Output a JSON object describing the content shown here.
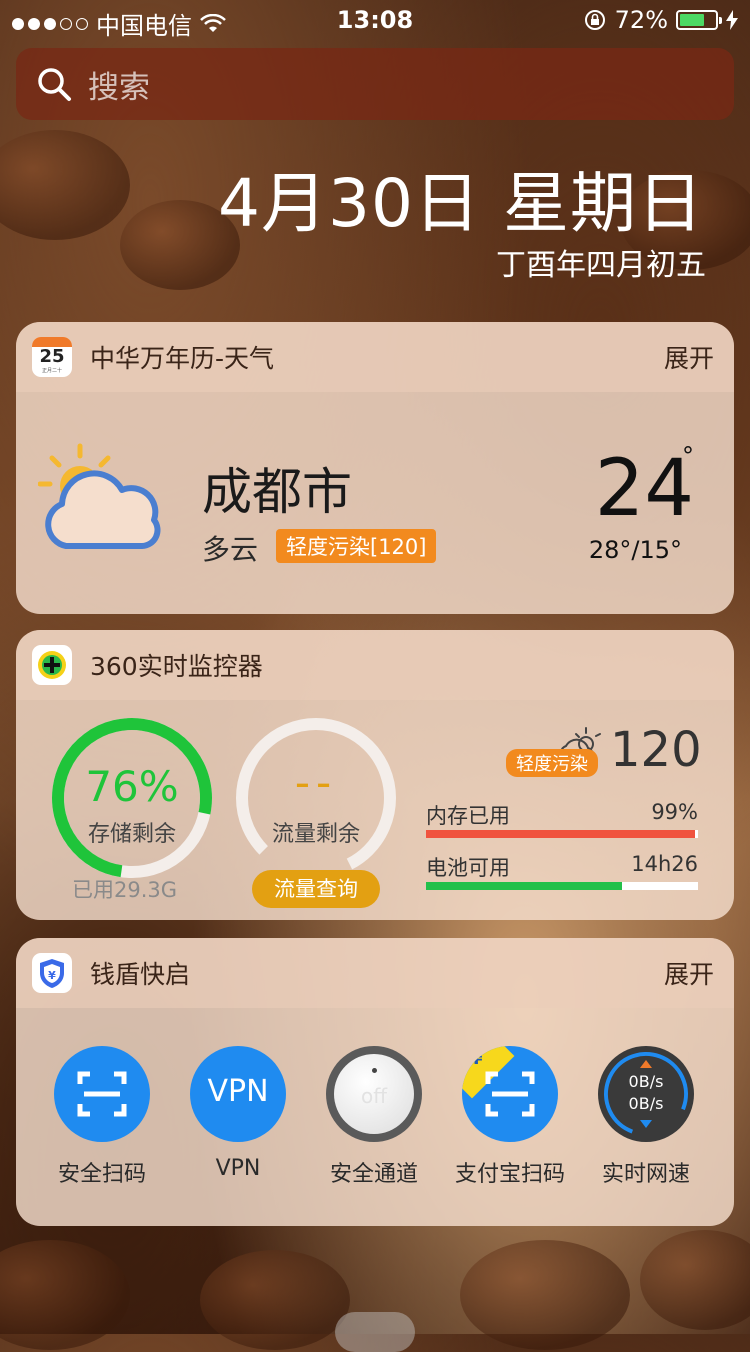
{
  "status_bar": {
    "carrier": "中国电信",
    "time": "13:08",
    "battery_percent": "72%",
    "battery_level": 0.72,
    "icons": [
      "signal-dots-icon",
      "wifi-icon",
      "rotation-lock-icon",
      "battery-icon",
      "charging-bolt-icon"
    ]
  },
  "search": {
    "placeholder": "搜索"
  },
  "header": {
    "date": "4月30日 星期日",
    "lunar": "丁酉年四月初五"
  },
  "weather_widget": {
    "title": "中华万年历-天气",
    "expand": "展开",
    "icon_day": "25",
    "icon_sub": "正月二十",
    "city": "成都市",
    "condition": "多云",
    "aqi": "轻度污染[120]",
    "temperature": "24",
    "degree": "°",
    "range": "28°/15°"
  },
  "monitor_widget": {
    "title": "360实时监控器",
    "storage_value": "76%",
    "storage_label": "存储剩余",
    "storage_used": "已用29.3G",
    "storage_fraction": 0.76,
    "flow_value": "--",
    "flow_label": "流量剩余",
    "flow_button": "流量查询",
    "aqi_badge": "轻度污染",
    "aqi_value": "120",
    "memory_label": "内存已用",
    "memory_value": "99%",
    "memory_fraction": 0.99,
    "battery_label": "电池可用",
    "battery_value": "14h26",
    "battery_fraction": 0.72
  },
  "qiandun_widget": {
    "title": "钱盾快启",
    "expand": "展开",
    "items": [
      {
        "label": "安全扫码",
        "icon": "scan-icon"
      },
      {
        "label": "VPN",
        "icon": "vpn-icon",
        "glyph": "VPN"
      },
      {
        "label": "安全通道",
        "icon": "toggle-off-icon",
        "glyph": "off"
      },
      {
        "label": "支付宝扫码",
        "icon": "alipay-scan-icon",
        "glyph": "¥"
      },
      {
        "label": "实时网速",
        "icon": "speed-meter-icon",
        "up": "0B/s",
        "down": "0B/s"
      }
    ]
  },
  "colors": {
    "accent_orange": "#f28a1e",
    "storage_green": "#1fc43a",
    "memory_red": "#f0533e",
    "battery_green": "#22c04a",
    "flow_button": "#e3a012",
    "qd_blue": "#1f8bf0"
  }
}
